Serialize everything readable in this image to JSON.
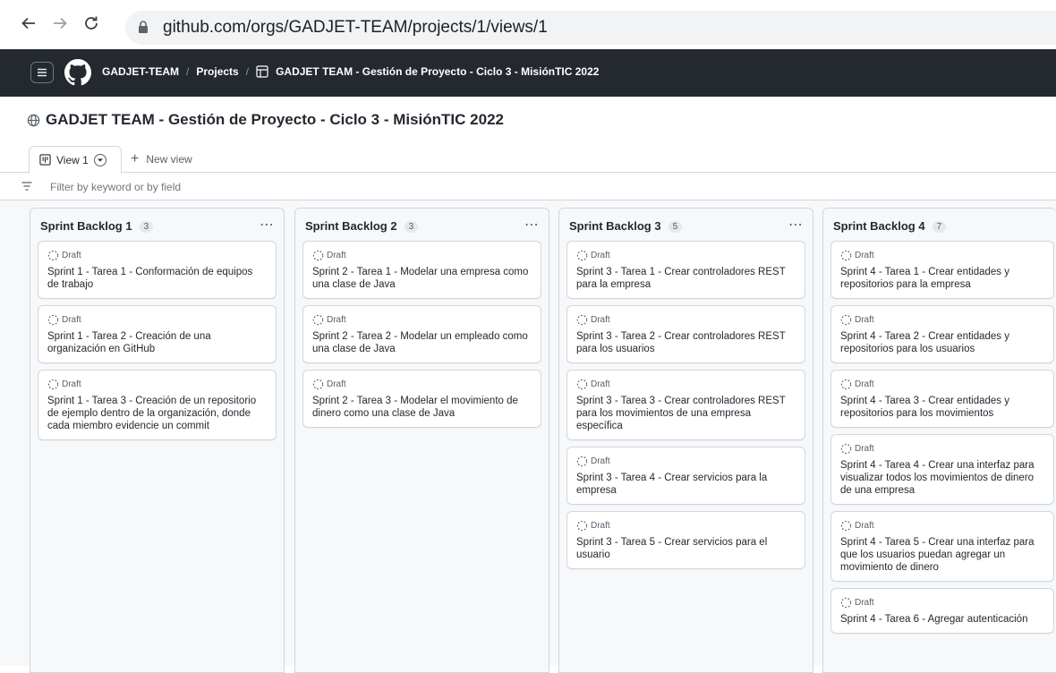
{
  "browser": {
    "url": "github.com/orgs/GADJET-TEAM/projects/1/views/1"
  },
  "header": {
    "org": "GADJET-TEAM",
    "projects": "Projects",
    "project": "GADJET TEAM - Gestión de Proyecto - Ciclo 3 - MisiónTIC 2022",
    "separator": "/"
  },
  "project_title": "GADJET TEAM - Gestión de Proyecto - Ciclo 3 - MisiónTIC 2022",
  "tabs": {
    "active": "View 1",
    "new_view": "New view"
  },
  "filter": {
    "placeholder": "Filter by keyword or by field"
  },
  "columns": [
    {
      "title": "Sprint Backlog 1",
      "count": "3",
      "cards": [
        {
          "status": "Draft",
          "title": "Sprint 1 - Tarea 1 - Conformación de equipos de trabajo"
        },
        {
          "status": "Draft",
          "title": "Sprint 1 - Tarea 2 - Creación de una organización en GitHub"
        },
        {
          "status": "Draft",
          "title": "Sprint 1 - Tarea 3 - Creación de un repositorio de ejemplo dentro de la organización, donde cada miembro evidencie un commit"
        }
      ]
    },
    {
      "title": "Sprint Backlog 2",
      "count": "3",
      "cards": [
        {
          "status": "Draft",
          "title": "Sprint 2 - Tarea 1 - Modelar una empresa como una clase de Java"
        },
        {
          "status": "Draft",
          "title": "Sprint 2 - Tarea 2 - Modelar un empleado como una clase de Java"
        },
        {
          "status": "Draft",
          "title": "Sprint 2 - Tarea 3 - Modelar el movimiento de dinero como una clase de Java"
        }
      ]
    },
    {
      "title": "Sprint Backlog 3",
      "count": "5",
      "cards": [
        {
          "status": "Draft",
          "title": "Sprint 3 - Tarea 1 - Crear controladores REST para la empresa"
        },
        {
          "status": "Draft",
          "title": "Sprint 3 - Tarea 2 - Crear controladores REST para los usuarios"
        },
        {
          "status": "Draft",
          "title": "Sprint 3 - Tarea 3 - Crear controladores REST para los movimientos de una empresa específica"
        },
        {
          "status": "Draft",
          "title": "Sprint 3 - Tarea 4 - Crear servicios para la empresa"
        },
        {
          "status": "Draft",
          "title": "Sprint 3 - Tarea 5 - Crear servicios para el usuario"
        }
      ]
    },
    {
      "title": "Sprint Backlog 4",
      "count": "7",
      "cards": [
        {
          "status": "Draft",
          "title": "Sprint 4 - Tarea 1 - Crear entidades y repositorios para la empresa"
        },
        {
          "status": "Draft",
          "title": "Sprint 4 - Tarea 2 - Crear entidades y repositorios para los usuarios"
        },
        {
          "status": "Draft",
          "title": "Sprint 4 - Tarea 3 - Crear entidades y repositorios para los movimientos"
        },
        {
          "status": "Draft",
          "title": "Sprint 4 - Tarea 4 - Crear una interfaz para visualizar todos los movimientos de dinero de una empresa"
        },
        {
          "status": "Draft",
          "title": "Sprint 4 - Tarea 5 - Crear una interfaz para que los usuarios puedan agregar un movimiento de dinero"
        },
        {
          "status": "Draft",
          "title": "Sprint 4 - Tarea 6 - Agregar autenticación"
        }
      ]
    }
  ],
  "colors": {
    "header_bg": "#24292f",
    "board_bg": "#f6f8fa",
    "border": "#d0d7de"
  }
}
